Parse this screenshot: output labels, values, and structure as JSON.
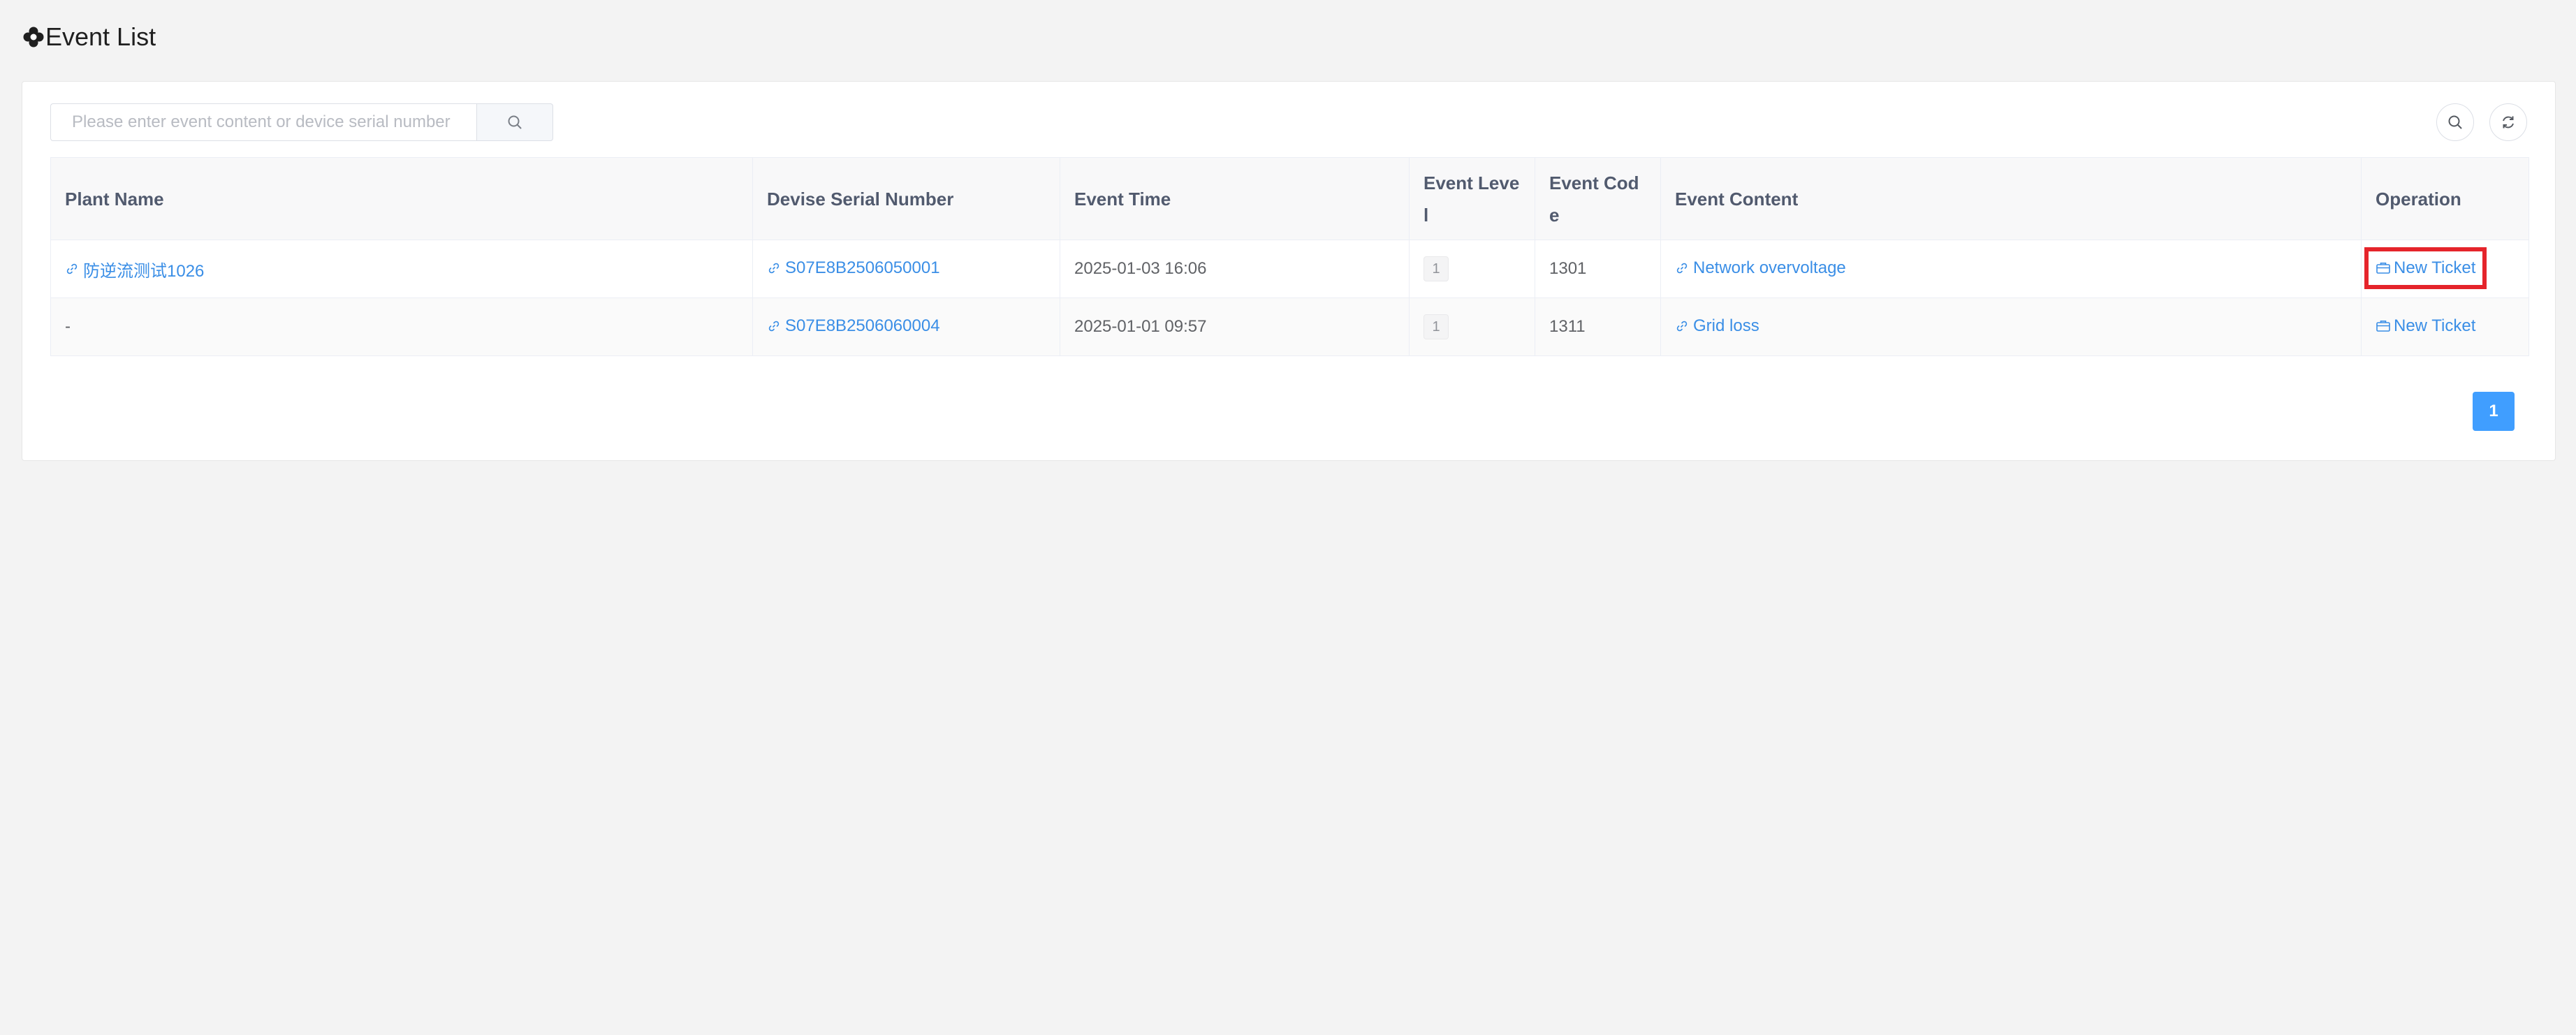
{
  "header": {
    "title": "Event List",
    "icon": "gear-flower-icon"
  },
  "search": {
    "placeholder": "Please enter event content or device serial number",
    "value": ""
  },
  "table": {
    "columns": [
      "Plant Name",
      "Devise Serial Number",
      "Event Time",
      "Event Level",
      "Event Code",
      "Event Content",
      "Operation"
    ],
    "rows": [
      {
        "plant_name": "防逆流测试1026",
        "serial": "S07E8B2506050001",
        "time": "2025-01-03 16:06",
        "level": "1",
        "code": "1301",
        "content": "Network overvoltage",
        "operation": "New Ticket"
      },
      {
        "plant_name": "-",
        "serial": "S07E8B2506060004",
        "time": "2025-01-01 09:57",
        "level": "1",
        "code": "1311",
        "content": "Grid loss",
        "operation": "New Ticket"
      }
    ]
  },
  "pagination": {
    "current_page": "1"
  },
  "colors": {
    "link": "#3a8ee6",
    "primary": "#409eff",
    "highlight": "#e5242b"
  }
}
